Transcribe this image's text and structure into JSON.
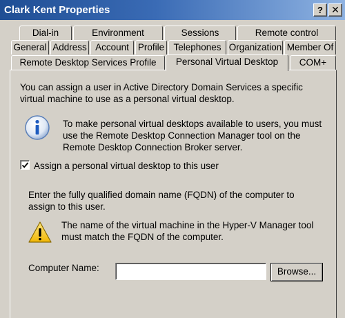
{
  "window": {
    "title": "Clark Kent Properties",
    "help_glyph": "?",
    "close_glyph": "✕"
  },
  "tabs": {
    "row1": [
      "Dial-in",
      "Environment",
      "Sessions",
      "Remote control"
    ],
    "row2": [
      "General",
      "Address",
      "Account",
      "Profile",
      "Telephones",
      "Organization",
      "Member Of"
    ],
    "row3": [
      "Remote Desktop Services Profile",
      "Personal Virtual Desktop",
      "COM+"
    ],
    "active": "Personal Virtual Desktop"
  },
  "panel": {
    "intro": "You can assign a user in Active Directory Domain Services a specific virtual machine to use as a personal virtual desktop.",
    "info": "To make personal virtual desktops available to users, you must use the Remote Desktop Connection Manager tool on the Remote Desktop Connection Broker server.",
    "checkbox_label": "Assign a personal virtual desktop to this user",
    "checkbox_checked": true,
    "fqdn_instructions": "Enter the fully qualified domain name (FQDN) of the computer to assign to this user.",
    "warning": "The name of the virtual machine in the Hyper-V Manager tool must match the FQDN of the computer.",
    "computer_name_label": "Computer Name:",
    "computer_name_value": "",
    "browse_label": "Browse..."
  },
  "icons": {
    "info": "info-icon",
    "warning": "warning-icon",
    "checkmark": "checkmark-icon"
  },
  "colors": {
    "titlebar_start": "#1f4e94",
    "titlebar_end": "#8fb3e2",
    "dialog_bg": "#d4d0c8"
  }
}
